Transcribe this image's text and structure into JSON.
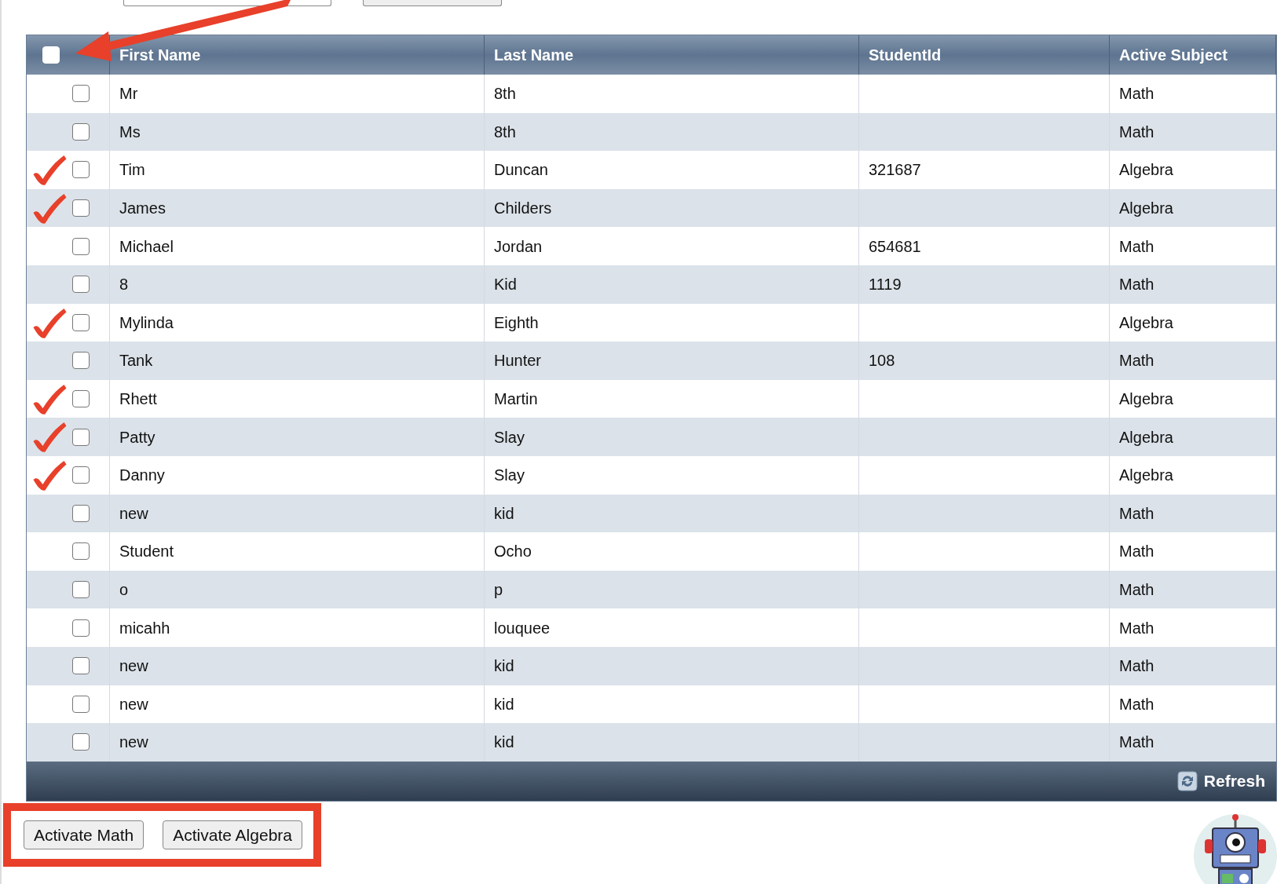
{
  "table": {
    "columns": [
      "First Name",
      "Last Name",
      "StudentId",
      "Active Subject"
    ],
    "header_checkbox": {
      "checked": false
    },
    "rows": [
      {
        "first_name": "Mr",
        "last_name": "8th",
        "active_subject": "Math",
        "checked": false,
        "annotated": false
      },
      {
        "first_name": "Ms",
        "last_name": "8th",
        "active_subject": "Math",
        "checked": false,
        "annotated": false
      },
      {
        "first_name": "Tim",
        "last_name": "Duncan",
        "student_id": "321687",
        "active_subject": "Algebra",
        "checked": false,
        "annotated": true
      },
      {
        "first_name": "James",
        "last_name": "Childers",
        "active_subject": "Algebra",
        "checked": false,
        "annotated": true
      },
      {
        "first_name": "Michael",
        "last_name": "Jordan",
        "student_id": "654681",
        "active_subject": "Math",
        "checked": false,
        "annotated": false
      },
      {
        "first_name": "8",
        "last_name": "Kid",
        "student_id": "1119",
        "active_subject": "Math",
        "checked": false,
        "annotated": false
      },
      {
        "first_name": "Mylinda",
        "last_name": "Eighth",
        "active_subject": "Algebra",
        "checked": false,
        "annotated": true
      },
      {
        "first_name": "Tank",
        "last_name": "Hunter",
        "student_id": "108",
        "active_subject": "Math",
        "checked": false,
        "annotated": false
      },
      {
        "first_name": "Rhett",
        "last_name": "Martin",
        "active_subject": "Algebra",
        "checked": false,
        "annotated": true
      },
      {
        "first_name": "Patty",
        "last_name": "Slay",
        "active_subject": "Algebra",
        "checked": false,
        "annotated": true
      },
      {
        "first_name": "Danny",
        "last_name": "Slay",
        "active_subject": "Algebra",
        "checked": false,
        "annotated": true
      },
      {
        "first_name": "new",
        "last_name": "kid",
        "active_subject": "Math",
        "checked": false,
        "annotated": false
      },
      {
        "first_name": "Student",
        "last_name": "Ocho",
        "active_subject": "Math",
        "checked": false,
        "annotated": false
      },
      {
        "first_name": "o",
        "last_name": "p",
        "active_subject": "Math",
        "checked": false,
        "annotated": false
      },
      {
        "first_name": "micahh",
        "last_name": "louquee",
        "active_subject": "Math",
        "checked": false,
        "annotated": false
      },
      {
        "first_name": "new",
        "last_name": "kid",
        "active_subject": "Math",
        "checked": false,
        "annotated": false
      },
      {
        "first_name": "new",
        "last_name": "kid",
        "active_subject": "Math",
        "checked": false,
        "annotated": false
      },
      {
        "first_name": "new",
        "last_name": "kid",
        "active_subject": "Math",
        "checked": false,
        "annotated": false
      }
    ],
    "footer": {
      "refresh_label": "Refresh"
    }
  },
  "actions": {
    "highlighted": true,
    "buttons": [
      "Activate Math",
      "Activate Algebra"
    ]
  },
  "annotation_arrow": true
}
